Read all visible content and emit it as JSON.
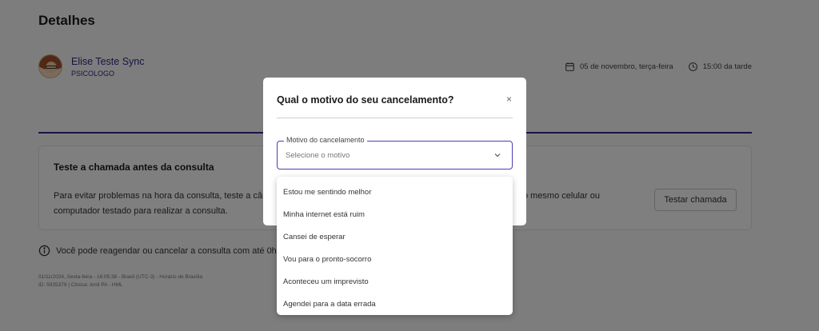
{
  "page": {
    "title": "Detalhes",
    "professional": {
      "name": "Elise Teste Sync",
      "role": "PSICOLOGO"
    },
    "meta": {
      "date": "05 de novembro, terça-feira",
      "time": "15:00 da tarde",
      "date_icon": "calendar-icon",
      "time_icon": "clock-icon"
    },
    "card": {
      "title": "Teste a chamada antes da consulta",
      "text": "Para evitar problemas na hora da consulta, teste a câmera, o microfone e a conexão com a internet. Lembre-se de usar o mesmo celular ou computador testado para realizar a consulta.",
      "button": "Testar chamada"
    },
    "notice": {
      "icon": "info-icon",
      "text": "Você pode reagendar ou cancelar a consulta com até 0h de antecedência."
    },
    "footer": {
      "line1": "01/11/2024, Sexta-feira - 16:05:38 - Brasil (UTC-3) - Horário de Brasília",
      "line2": "ID: 5935379 | Clínica: Amil PA - HML"
    }
  },
  "modal": {
    "title": "Qual o motivo do seu cancelamento?",
    "close": "×",
    "select": {
      "label": "Motivo do cancelamento",
      "placeholder": "Selecione o motivo",
      "icon": "chevron-down-icon"
    },
    "options": [
      "Estou me sentindo melhor",
      "Minha internet está ruim",
      "Cansei de esperar",
      "Vou para o pronto-socorro",
      "Aconteceu um imprevisto",
      "Agendei para a data errada"
    ]
  },
  "colors": {
    "accent": "#2d2a8a",
    "select_border": "#4a3fb5",
    "overlay": "rgba(0,0,0,0.5)"
  }
}
